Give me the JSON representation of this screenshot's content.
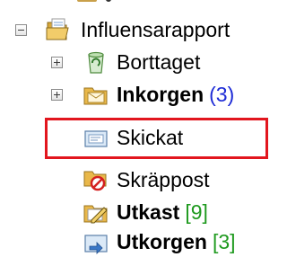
{
  "tree": {
    "root": {
      "label": "Influensarapport",
      "toggle": "minus",
      "icon": "folder-open-icon"
    },
    "items": [
      {
        "label": "Borttaget",
        "toggle": "plus",
        "icon": "recycle-bin-icon",
        "bold": false,
        "count": ""
      },
      {
        "label": "Inkorgen",
        "toggle": "plus",
        "icon": "inbox-folder-icon",
        "bold": true,
        "count": "(3)"
      },
      {
        "label": "Skickat",
        "toggle": "none",
        "icon": "sent-items-icon",
        "bold": false,
        "count": "",
        "selected": true
      },
      {
        "label": "Skräppost",
        "toggle": "none",
        "icon": "junk-mail-icon",
        "bold": false,
        "count": ""
      },
      {
        "label": "Utkast",
        "toggle": "none",
        "icon": "drafts-icon",
        "bold": true,
        "count": "[9]"
      },
      {
        "label": "Utkorgen",
        "toggle": "none",
        "icon": "outbox-icon",
        "bold": true,
        "count": "[3]"
      }
    ]
  },
  "colors": {
    "unread_count": "#1d2bd6",
    "draft_count": "#1f9a1f",
    "selection_border": "#e2161e"
  }
}
